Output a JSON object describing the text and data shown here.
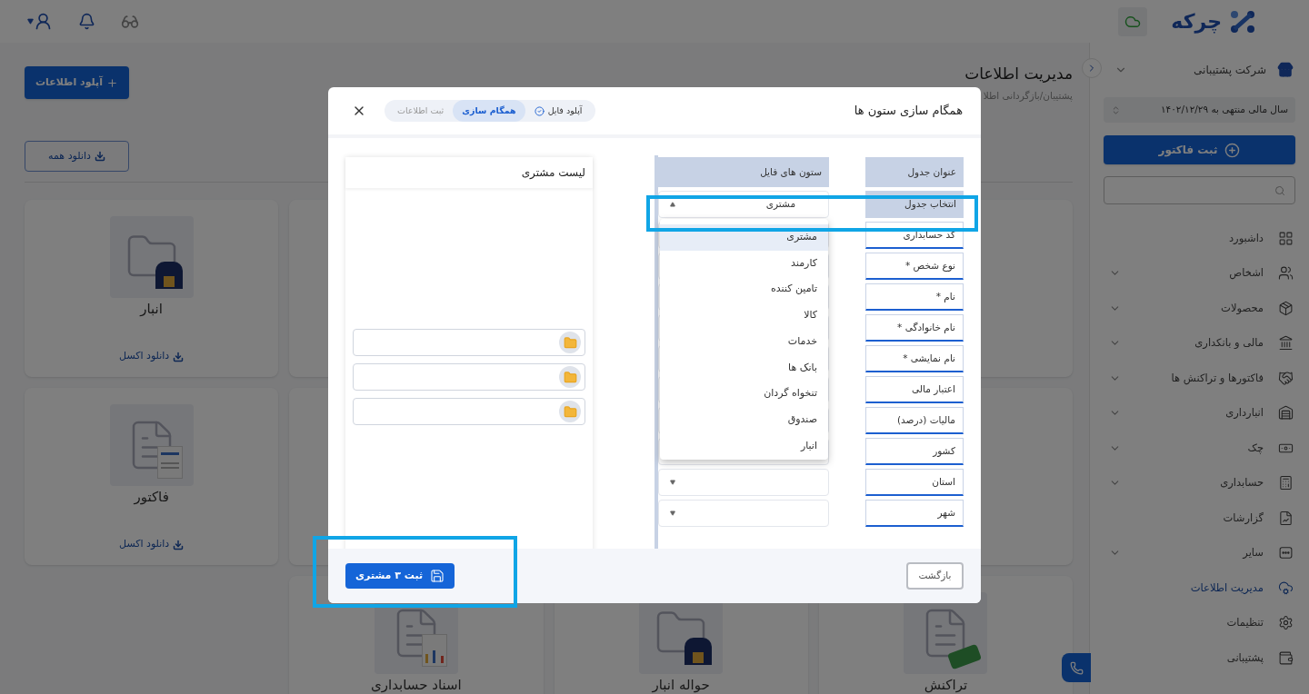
{
  "topbar": {
    "logo_text": "چرکه"
  },
  "sidebar": {
    "company": "شرکت پشتیبانی",
    "fiscal_year": "سال مالی منتهی به ۱۴۰۲/۱۲/۲۹",
    "new_invoice_button": "ثبت فاکتور",
    "items": [
      {
        "label": "داشبورد",
        "expandable": false,
        "selected": false
      },
      {
        "label": "اشخاص",
        "expandable": true,
        "selected": false
      },
      {
        "label": "محصولات",
        "expandable": true,
        "selected": false
      },
      {
        "label": "مالی و بانکداری",
        "expandable": true,
        "selected": false
      },
      {
        "label": "فاکتورها و تراکنش ها",
        "expandable": true,
        "selected": false
      },
      {
        "label": "انبارداری",
        "expandable": true,
        "selected": false
      },
      {
        "label": "چک",
        "expandable": true,
        "selected": false
      },
      {
        "label": "حسابداری",
        "expandable": true,
        "selected": false
      },
      {
        "label": "گزارشات",
        "expandable": false,
        "selected": false
      },
      {
        "label": "سایر",
        "expandable": true,
        "selected": false
      },
      {
        "label": "مدیریت اطلاعات",
        "expandable": false,
        "selected": true
      },
      {
        "label": "تنظیمات",
        "expandable": false,
        "selected": false
      },
      {
        "label": "پشتیبانی",
        "expandable": false,
        "selected": false
      }
    ]
  },
  "page": {
    "title": "مدیریت اطلاعات",
    "subtitle": "پشتیبان/بازگردانی اطلا",
    "upload_button": "آپلود اطلاعات",
    "download_all_button": "دانلود همه",
    "cards": [
      {
        "title": "انبار",
        "kind": "warehouse",
        "download": "دانلود اکسل"
      },
      {
        "title": "فاکتور",
        "kind": "invoice",
        "download": "دانلود اکسل"
      },
      {
        "title": "تراکنش",
        "kind": "transaction"
      },
      {
        "title": "حواله انبار",
        "kind": "warehouse"
      },
      {
        "title": "اسناد حسابداری",
        "kind": "report"
      }
    ]
  },
  "modal": {
    "title": "همگام سازی ستون ها",
    "steps": [
      {
        "label": "آپلود فایل",
        "done": true,
        "selected": false
      },
      {
        "label": "همگام سازی",
        "done": false,
        "selected": true
      },
      {
        "label": "ثبت اطلاعات",
        "done": false,
        "selected": false
      }
    ],
    "columns": [
      "عنوان جدول",
      "ستون های فایل"
    ],
    "table_select": {
      "label": "انتخاب جدول",
      "value": "مشتری",
      "expanded": true,
      "options": [
        {
          "label": "مشتری",
          "selected": true
        },
        {
          "label": "کارمند",
          "selected": false
        },
        {
          "label": "تامین کننده",
          "selected": false
        },
        {
          "label": "کالا",
          "selected": false
        },
        {
          "label": "خدمات",
          "selected": false
        },
        {
          "label": "بانک ها",
          "selected": false
        },
        {
          "label": "تنخواه گردان",
          "selected": false
        },
        {
          "label": "صندوق",
          "selected": false
        },
        {
          "label": "انبار",
          "selected": false
        }
      ]
    },
    "rows": [
      {
        "label": "کد حسابداری"
      },
      {
        "label": "نوع شخص *"
      },
      {
        "label": "نام *"
      },
      {
        "label": "نام خانوادگی *"
      },
      {
        "label": "نام نمایشی *"
      },
      {
        "label": "اعتبار مالی"
      },
      {
        "label": "مالیات (درصد)"
      },
      {
        "label": "کشور"
      },
      {
        "label": "استان"
      },
      {
        "label": "شهر"
      }
    ],
    "list_panel": {
      "title": "لیست مشتری",
      "slots": [
        {
          "kind": "folder"
        },
        {
          "kind": "folder"
        },
        {
          "kind": "folder"
        }
      ]
    },
    "back_button": "بازگشت",
    "submit_button": "ثبت ۳ مشتری"
  }
}
